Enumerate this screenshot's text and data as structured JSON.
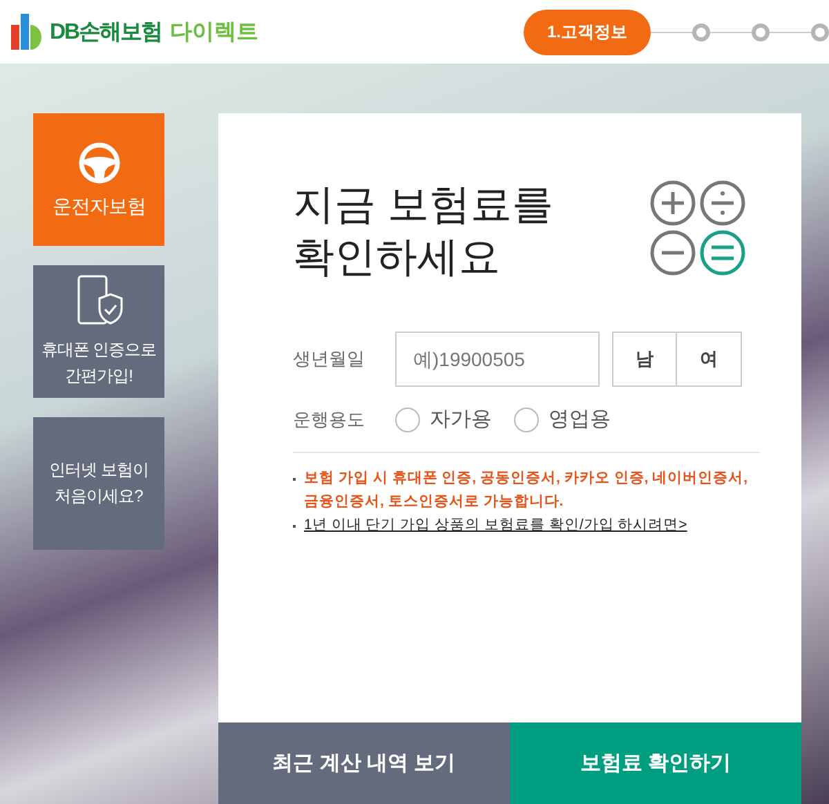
{
  "header": {
    "logo_brand": "DB손해보험",
    "logo_suffix": "다이렉트",
    "steps": [
      {
        "label": "1.고객정보",
        "selected": true
      },
      {
        "selected": false
      },
      {
        "selected": false
      },
      {
        "selected": false
      }
    ]
  },
  "side_tiles": [
    {
      "kind": "wheel",
      "label": "운전자보험",
      "selected": true
    },
    {
      "kind": "phone",
      "label": "휴대폰 인증으로 간편가입!",
      "selected": false
    },
    {
      "kind": "text",
      "label": "인터넷 보험이 처음이세요?",
      "selected": false
    }
  ],
  "card": {
    "title": "지금 보험료를 확인하세요",
    "birth": {
      "label": "생년월일",
      "placeholder": "예)19900505"
    },
    "gender": [
      {
        "label": "남",
        "selected": false
      },
      {
        "label": "여",
        "selected": false
      }
    ],
    "usage": {
      "label": "운행용도",
      "options": [
        {
          "label": "자가용",
          "selected": false
        },
        {
          "label": "영업용",
          "selected": false
        }
      ]
    },
    "notes": [
      {
        "kind": "warning",
        "text": "보험 가입 시 휴대폰 인증, 공동인증서, 카카오 인증, 네이버인증서, 금융인증서, 토스인증서로 가능합니다."
      },
      {
        "kind": "link",
        "text": "1년 이내 단기 가입 상품의 보험료를 확인/가입 하시려면>"
      }
    ]
  },
  "buttons": [
    {
      "kind": "secondary",
      "label": "최근 계산 내역 보기"
    },
    {
      "kind": "primary",
      "label": "보험료 확인하기"
    }
  ]
}
